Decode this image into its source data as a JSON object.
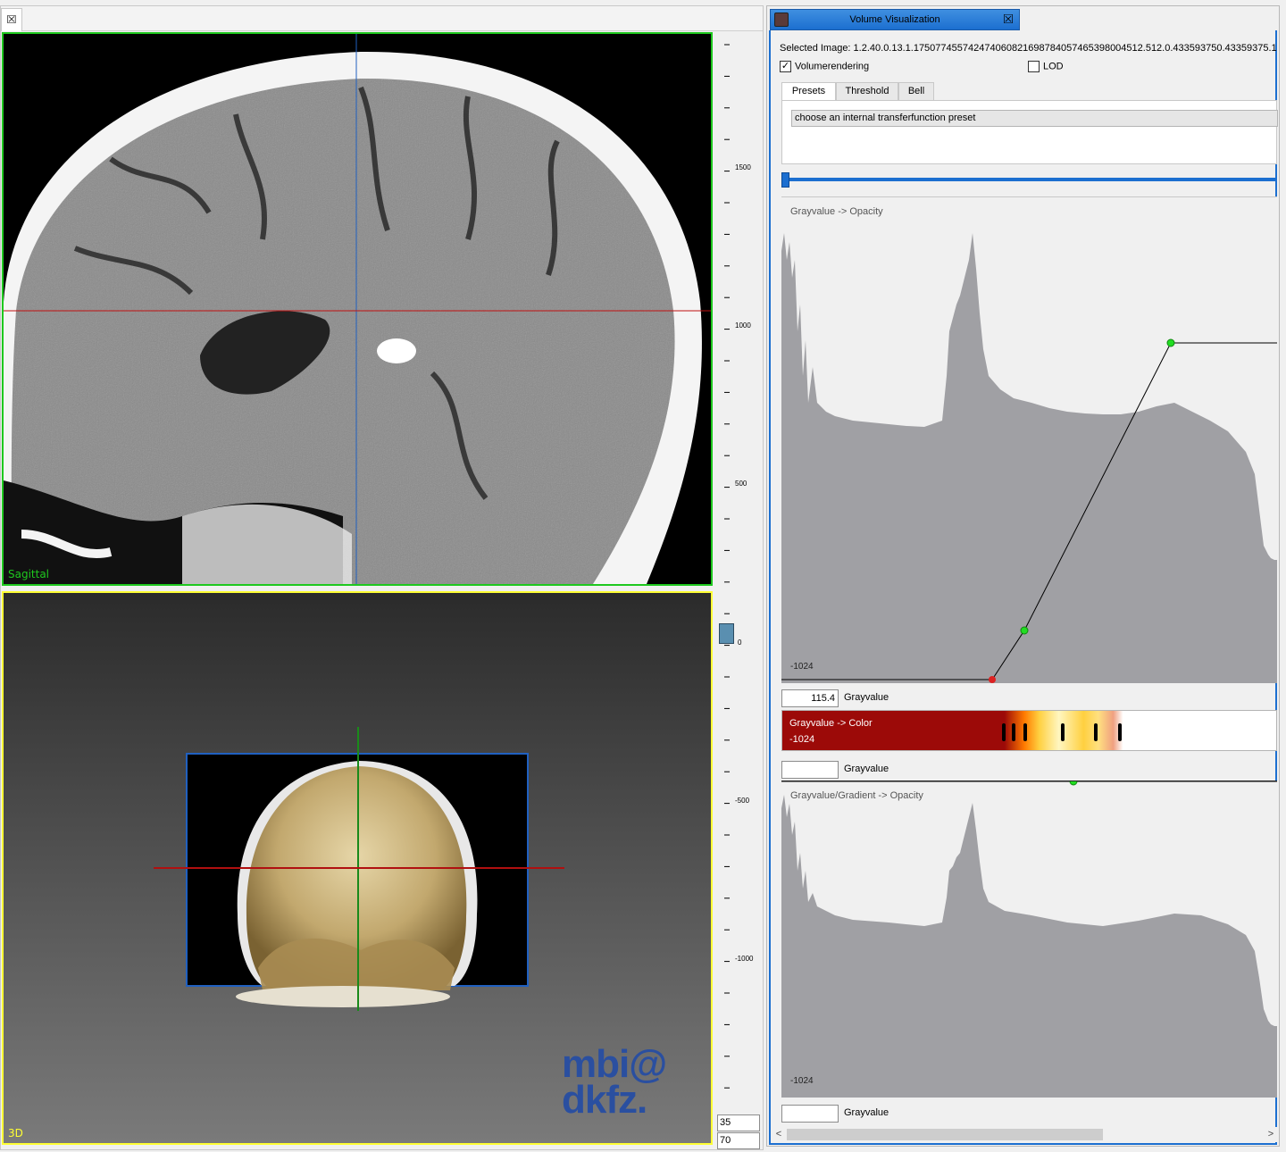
{
  "left_view": {
    "close_glyph": "⮽",
    "sagittal_label": "Sagittal",
    "threed_label": "3D",
    "watermark_lines": [
      "mbi@",
      "dkfz."
    ]
  },
  "level_window": {
    "tick_labels": [
      "1500",
      "1000",
      "500",
      "0",
      "-500",
      "-1000"
    ],
    "level_value": "35",
    "window_value": "70"
  },
  "volume_panel": {
    "tab_title": "Volume Visualization",
    "close_glyph": "⮽",
    "selected_image_label": "Selected Image: 1.2.40.0.13.1.175077455742474060821698784057465398004512.512.0.433593750.43359375.1",
    "volumerendering": {
      "label": "Volumerendering",
      "checked": true,
      "check_glyph": "✓"
    },
    "lod": {
      "label": "LOD",
      "checked": false
    },
    "tabs": [
      "Presets",
      "Threshold",
      "Bell"
    ],
    "preset_combo": "choose an internal transferfunction preset",
    "opacity_plot": {
      "title": "Grayvalue -> Opacity",
      "min_label": "-1024"
    },
    "opacity_grayvalue": {
      "value": "115.4",
      "label": "Grayvalue"
    },
    "color_bar": {
      "title": "Grayvalue -> Color",
      "min_label": "-1024"
    },
    "color_grayvalue": {
      "value": "",
      "label": "Grayvalue"
    },
    "gradient_plot": {
      "title": "Grayvalue/Gradient -> Opacity",
      "min_label": "-1024"
    },
    "gradient_grayvalue": {
      "value": "",
      "label": "Grayvalue"
    },
    "scroll_left": "<",
    "scroll_right": ">"
  },
  "colors": {
    "sagittal_border": "#1ec81e",
    "threed_border": "#ffff33",
    "accent_blue": "#1c6fd0",
    "histogram_gray": "#a0a0a4",
    "control_point_green": "#22dd22",
    "control_point_red": "#dd2222",
    "watermark_blue": "#2a4fa0"
  }
}
